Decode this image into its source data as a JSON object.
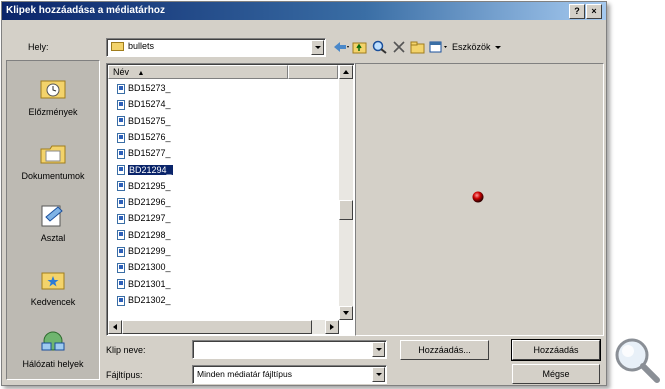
{
  "window": {
    "title": "Klipek hozzáadása a médiatárhoz",
    "help_label": "?",
    "close_label": "×"
  },
  "location": {
    "label": "Hely:",
    "value": "bullets"
  },
  "toolbar": {
    "tools_label": "Eszközök"
  },
  "places": [
    {
      "label": "Előzmények",
      "icon": "history-icon"
    },
    {
      "label": "Dokumentumok",
      "icon": "documents-icon"
    },
    {
      "label": "Asztal",
      "icon": "desktop-icon"
    },
    {
      "label": "Kedvencek",
      "icon": "favorites-icon"
    },
    {
      "label": "Hálózati helyek",
      "icon": "network-places-icon"
    }
  ],
  "file_list": {
    "column_name": "Név",
    "sort_indicator": "▲",
    "files": [
      "BD15273_",
      "BD15274_",
      "BD15275_",
      "BD15276_",
      "BD15277_",
      "BD21294_",
      "BD21295_",
      "BD21296_",
      "BD21297_",
      "BD21298_",
      "BD21299_",
      "BD21300_",
      "BD21301_",
      "BD21302_"
    ],
    "selected_index": 5
  },
  "filename": {
    "label": "Klip neve:",
    "value": ""
  },
  "filetype": {
    "label": "Fájltípus:",
    "value": "Minden médiatár fájltípus"
  },
  "buttons": {
    "add_to": "Hozzáadás...",
    "add": "Hozzáadás",
    "cancel": "Mégse"
  },
  "colors": {
    "title_start": "#0a246a",
    "title_end": "#a6caf0",
    "selection": "#0a246a",
    "preview_dot": "#cc0000"
  }
}
